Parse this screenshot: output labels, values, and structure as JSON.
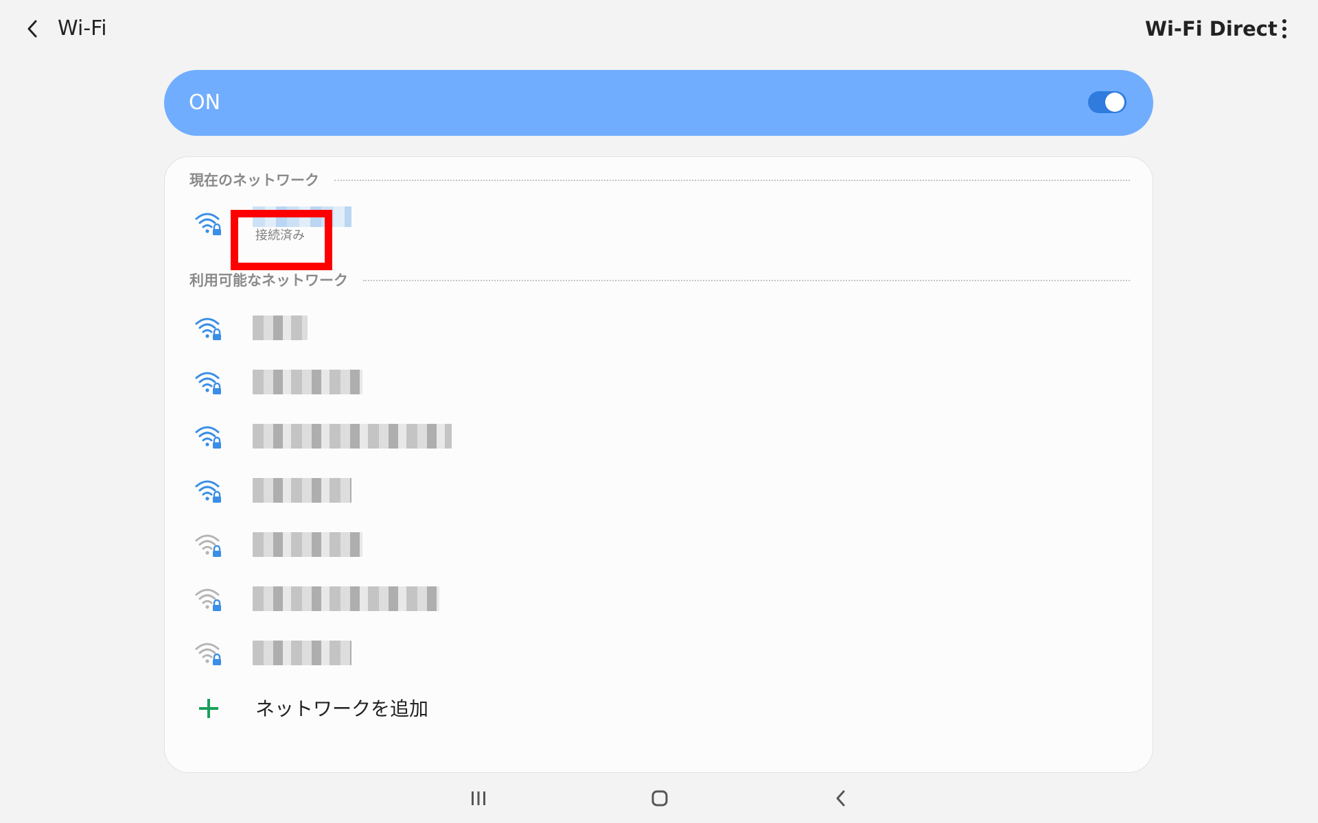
{
  "header": {
    "title": "Wi-Fi",
    "wifi_direct_label": "Wi-Fi Direct"
  },
  "master_switch": {
    "label": "ON",
    "state": "on"
  },
  "current_network": {
    "section_title": "現在のネットワーク",
    "network": {
      "signal": "full",
      "secured": true,
      "status": "接続済み"
    }
  },
  "available_networks": {
    "section_title": "利用可能なネットワーク",
    "items": [
      {
        "signal": "full",
        "secured": true
      },
      {
        "signal": "full",
        "secured": true
      },
      {
        "signal": "full",
        "secured": true
      },
      {
        "signal": "full",
        "secured": true
      },
      {
        "signal": "weak",
        "secured": true
      },
      {
        "signal": "weak",
        "secured": true
      },
      {
        "signal": "weak",
        "secured": true
      }
    ]
  },
  "add_network": {
    "label": "ネットワークを追加"
  },
  "colors": {
    "accent_blue": "#71adfe",
    "toggle_blue": "#2f7bde",
    "wifi_strong": "#3a8ee6",
    "wifi_weak": "#b5b5b5",
    "add_green": "#1ba05a",
    "highlight_red": "#ff0000"
  },
  "system_nav": {
    "icons": [
      "recents-icon",
      "home-icon",
      "back-icon"
    ]
  }
}
